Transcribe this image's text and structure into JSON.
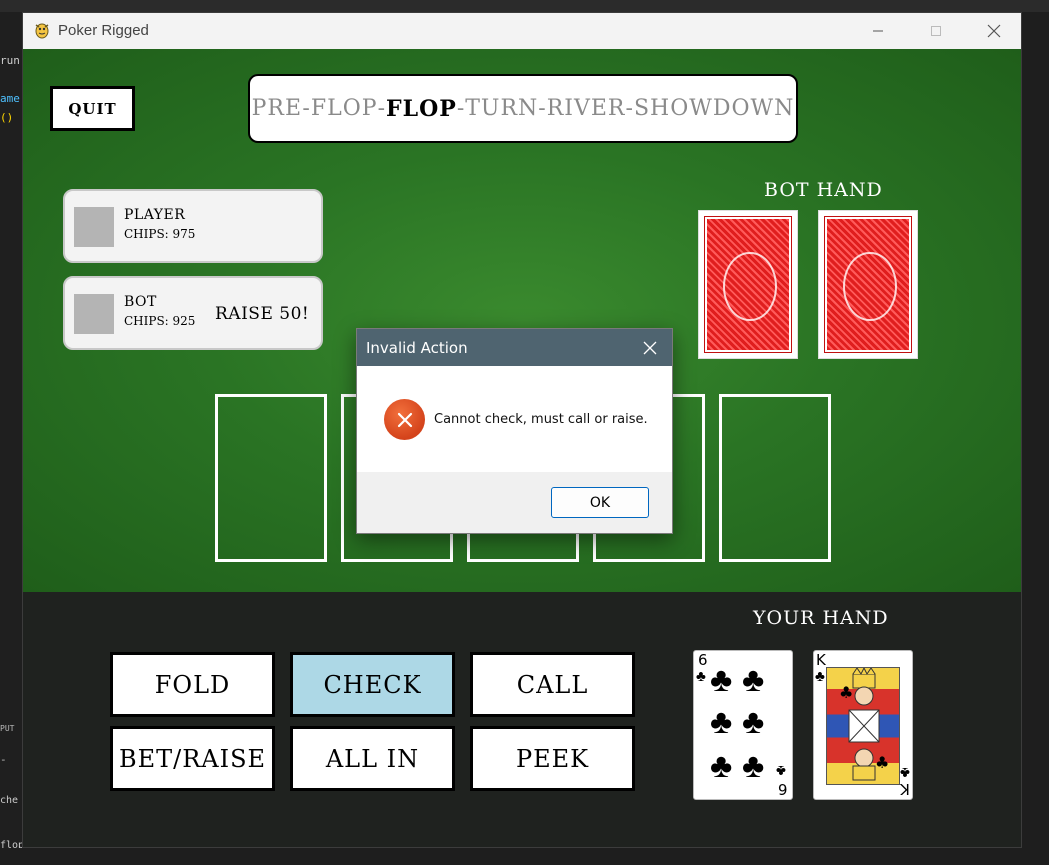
{
  "window": {
    "title": "Poker Rigged"
  },
  "background_ide": {
    "fragments": [
      "run",
      "ame",
      "()",
      "PUT",
      "-",
      "che",
      "flop"
    ]
  },
  "game": {
    "quit_label": "QUIT",
    "stages": [
      "PRE-FLOP",
      "FLOP",
      "TURN",
      "RIVER",
      "SHOWDOWN"
    ],
    "active_stage": "FLOP",
    "players": [
      {
        "name": "PLAYER",
        "chips": "CHIPS: 975",
        "action": ""
      },
      {
        "name": "BOT",
        "chips": "CHIPS: 925",
        "action": "RAISE 50!"
      }
    ],
    "bot_hand_label": "BOT HAND",
    "your_hand_label": "YOUR HAND",
    "your_cards": [
      {
        "rank": "6",
        "suit": "♣"
      },
      {
        "rank": "K",
        "suit": "♣"
      }
    ],
    "actions": [
      {
        "label": "FOLD",
        "highlighted": false
      },
      {
        "label": "CHECK",
        "highlighted": true
      },
      {
        "label": "CALL",
        "highlighted": false
      },
      {
        "label": "BET/RAISE",
        "highlighted": false
      },
      {
        "label": "ALL IN",
        "highlighted": false
      },
      {
        "label": "PEEK",
        "highlighted": false
      }
    ]
  },
  "dialog": {
    "title": "Invalid Action",
    "message": "Cannot check, must call or raise.",
    "ok_label": "OK",
    "icon": "error-icon"
  },
  "colors": {
    "table_green": "#2a7424",
    "panel_dark": "#1f221f",
    "highlight_button": "#add8e6",
    "dialog_titlebar": "#4f6470",
    "card_back_red": "#e01e1e"
  }
}
